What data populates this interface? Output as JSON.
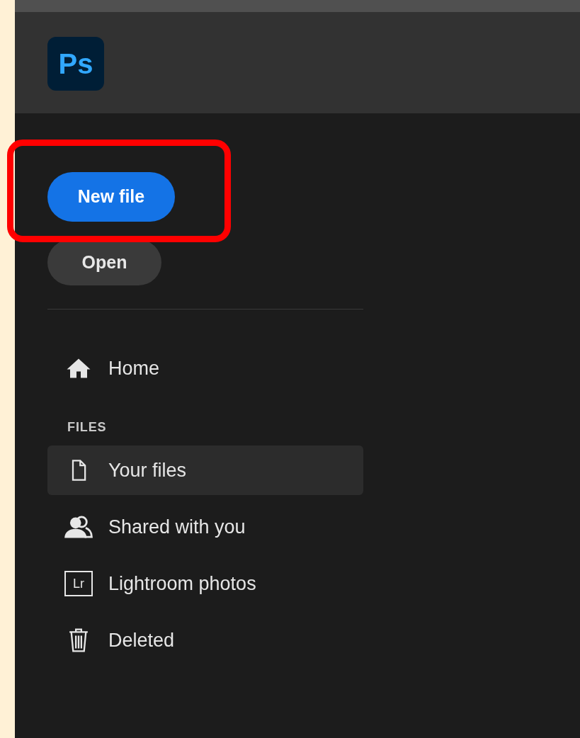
{
  "app_logo": {
    "text": "Ps"
  },
  "actions": [
    {
      "label": "New file",
      "kind": "primary",
      "highlighted": true
    },
    {
      "label": "Open",
      "kind": "secondary",
      "highlighted": false
    }
  ],
  "nav": {
    "items": [
      {
        "label": "Home",
        "kind": "home",
        "selected": false
      }
    ]
  },
  "files_section": {
    "heading": "FILES",
    "items": [
      {
        "label": "Your files",
        "kind": "file",
        "selected": true
      },
      {
        "label": "Shared with you",
        "kind": "shared",
        "selected": false
      },
      {
        "label": "Lightroom photos",
        "kind": "lightroom",
        "icon_text": "Lr",
        "selected": false
      },
      {
        "label": "Deleted",
        "kind": "trash",
        "selected": false
      }
    ]
  }
}
